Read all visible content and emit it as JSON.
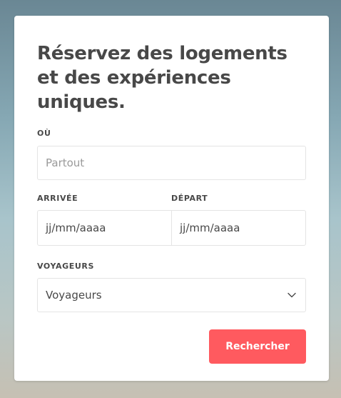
{
  "form": {
    "headline": "Réservez des logements et des expériences uniques.",
    "where_label": "OÙ",
    "where_placeholder": "Partout",
    "checkin_label": "ARRIVÉE",
    "checkout_label": "DÉPART",
    "checkin_value": "jj/mm/aaaa",
    "checkout_value": "jj/mm/aaaa",
    "guests_label": "VOYAGEURS",
    "guests_value": "Voyageurs",
    "submit_label": "Rechercher"
  },
  "icons": {
    "guests_dropdown": "chevron-down-icon"
  },
  "colors": {
    "accent": "#ff5a5f",
    "text": "#484848",
    "border": "#e4e4e4"
  }
}
